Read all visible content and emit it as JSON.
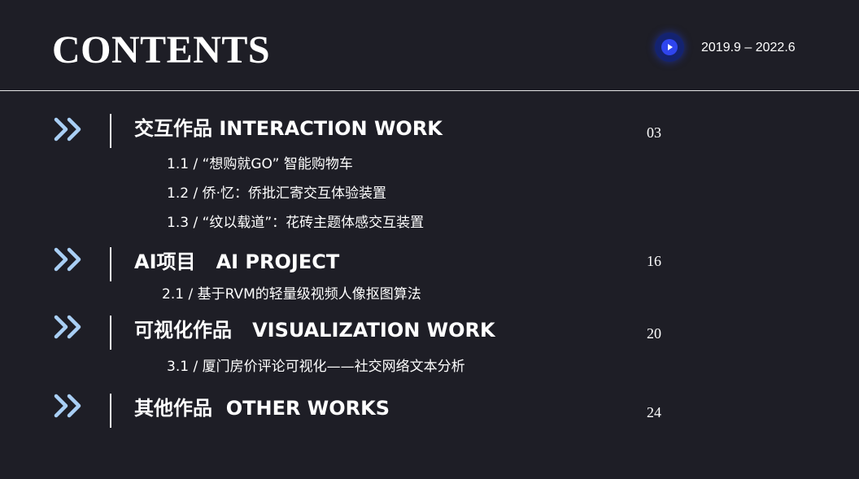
{
  "header": {
    "title": "CONTENTS",
    "date_range": "2019.9 – 2022.6",
    "icon": "play-icon",
    "accent_color": "#2f45ee",
    "chevron_color": "#a9cff5"
  },
  "sections": [
    {
      "title": "交互作品 INTERACTION WORK",
      "page": "03",
      "items": [
        "1.1 / “想购就GO” 智能购物车",
        "1.2 / 侨·忆：侨批汇寄交互体验装置",
        "1.3 / “纹以载道”：花砖主题体感交互装置"
      ]
    },
    {
      "title": "AI项目   AI PROJECT",
      "page": "16",
      "items": [
        "2.1 / 基于RVM的轻量级视频人像抠图算法"
      ]
    },
    {
      "title": "可视化作品   VISUALIZATION WORK",
      "page": "20",
      "items": [
        "3.1 / 厦门房价评论可视化——社交网络文本分析"
      ]
    },
    {
      "title": "其他作品  OTHER WORKS",
      "page": "24",
      "items": []
    }
  ]
}
